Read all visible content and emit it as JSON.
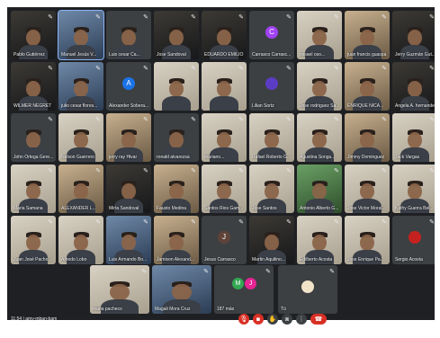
{
  "meeting": {
    "time": "11:54",
    "code": "amy-mban-bam",
    "separator": "|"
  },
  "participants": [
    {
      "name": "Pablo Gutiérrez",
      "type": "video",
      "tone": "dark"
    },
    {
      "name": "Manuel Jesús V...",
      "type": "video",
      "tone": "blue",
      "speaking": true
    },
    {
      "name": "Luis cesar Ca...",
      "type": "video",
      "tone": "gray"
    },
    {
      "name": "Jose Sandoval",
      "type": "video",
      "tone": "dark"
    },
    {
      "name": "EDUARDO EMILIO",
      "type": "video",
      "tone": "dark"
    },
    {
      "name": "Carrasco Carrasc...",
      "type": "avatar",
      "initial": "C",
      "avatar_color": "#a142f4"
    },
    {
      "name": "misael oso...",
      "type": "video",
      "tone": "light"
    },
    {
      "name": "juan francis guaspa",
      "type": "video",
      "tone": "tan"
    },
    {
      "name": "Jerry Guzmán Gut...",
      "type": "video",
      "tone": "dark"
    },
    {
      "name": "WILMER NEGRET",
      "type": "video",
      "tone": "dark"
    },
    {
      "name": "julio cesar flores...",
      "type": "video",
      "tone": "blue"
    },
    {
      "name": "Alexander Sobera...",
      "type": "avatar",
      "initial": "A",
      "avatar_color": "#1a73e8"
    },
    {
      "name": "",
      "type": "video",
      "tone": "light"
    },
    {
      "name": "",
      "type": "video",
      "tone": "light"
    },
    {
      "name": "Lilian Sortz",
      "type": "avatar",
      "initial": "",
      "avatar_color": "#5b3cc4"
    },
    {
      "name": "Jose rodriguez Sa...",
      "type": "video",
      "tone": "light"
    },
    {
      "name": "ENRIQUE NICA...",
      "type": "video",
      "tone": "tan"
    },
    {
      "name": "Angela A. hernandez...",
      "type": "video",
      "tone": "dark"
    },
    {
      "name": "John Ortega Gere...",
      "type": "video",
      "tone": "gray"
    },
    {
      "name": "Nelson Guerrero",
      "type": "video",
      "tone": "light"
    },
    {
      "name": "jerry ray Hivar",
      "type": "video",
      "tone": "tan"
    },
    {
      "name": "ronald alvarezsa",
      "type": "video",
      "tone": "gray"
    },
    {
      "name": "mariano...",
      "type": "video",
      "tone": "light"
    },
    {
      "name": "Rafael Roberto G...",
      "type": "video",
      "tone": "light"
    },
    {
      "name": "Agustina Songu...",
      "type": "video",
      "tone": "light"
    },
    {
      "name": "Jimmy Dominguez",
      "type": "video",
      "tone": "tan"
    },
    {
      "name": "Jack Vargas",
      "type": "video",
      "tone": "light"
    },
    {
      "name": "Maria Samana",
      "type": "video",
      "tone": "light"
    },
    {
      "name": "ALEXANDER L...",
      "type": "video",
      "tone": "tan"
    },
    {
      "name": "Mirta Sandoval",
      "type": "video",
      "tone": "dark"
    },
    {
      "name": "Fausto Medina",
      "type": "video",
      "tone": "tan"
    },
    {
      "name": "Santos Rios Gam...",
      "type": "video",
      "tone": "light"
    },
    {
      "name": "Jose Santos",
      "type": "video",
      "tone": "light"
    },
    {
      "name": "Antonio Alberto G...",
      "type": "video",
      "tone": "green"
    },
    {
      "name": "Jose Victor Moral...",
      "type": "video",
      "tone": "light"
    },
    {
      "name": "Kathy Guerra Bel...",
      "type": "video",
      "tone": "light"
    },
    {
      "name": "Juan José Pacho...",
      "type": "video",
      "tone": "light"
    },
    {
      "name": "Alfredo Lobo",
      "type": "video",
      "tone": "light"
    },
    {
      "name": "Luis Armando Bo...",
      "type": "video",
      "tone": "blue"
    },
    {
      "name": "Jamison Alexand...",
      "type": "video",
      "tone": "tan"
    },
    {
      "name": "Jesus Carrasco",
      "type": "avatar",
      "initial": "J",
      "avatar_color": "#5f4339"
    },
    {
      "name": "Martin Aquilino...",
      "type": "video",
      "tone": "dark"
    },
    {
      "name": "Edilberto Acosta",
      "type": "video",
      "tone": "light"
    },
    {
      "name": "Jose Enrique Pa...",
      "type": "video",
      "tone": "light"
    },
    {
      "name": "Sergio Acosta",
      "type": "avatar",
      "initial": "",
      "avatar_color": "#c5221f"
    },
    {
      "name": "maria pacheco",
      "type": "video",
      "tone": "light",
      "wide": true
    },
    {
      "name": "Magali Mora Cruz",
      "type": "video",
      "tone": "blue",
      "wide": true
    },
    {
      "name": "187 más",
      "type": "others",
      "initials": [
        "M",
        "J"
      ],
      "avatar_colors": [
        "#34a853",
        "#e52592"
      ],
      "wide": true
    },
    {
      "name": "Tú",
      "type": "avatar",
      "initial": "",
      "avatar_color": "#f1e3c8",
      "wide": true
    }
  ],
  "controls": [
    {
      "icon": "mic-off-icon",
      "glyph": "🎙",
      "style": "red"
    },
    {
      "icon": "camera-off-icon",
      "glyph": "▪",
      "style": "red"
    },
    {
      "icon": "raise-hand-icon",
      "glyph": "✋",
      "style": "grey"
    },
    {
      "icon": "present-icon",
      "glyph": "⧈",
      "style": "grey"
    },
    {
      "icon": "more-options-icon",
      "glyph": "⋮",
      "style": "grey"
    },
    {
      "icon": "hang-up-icon",
      "glyph": "☎",
      "style": "hang"
    }
  ]
}
